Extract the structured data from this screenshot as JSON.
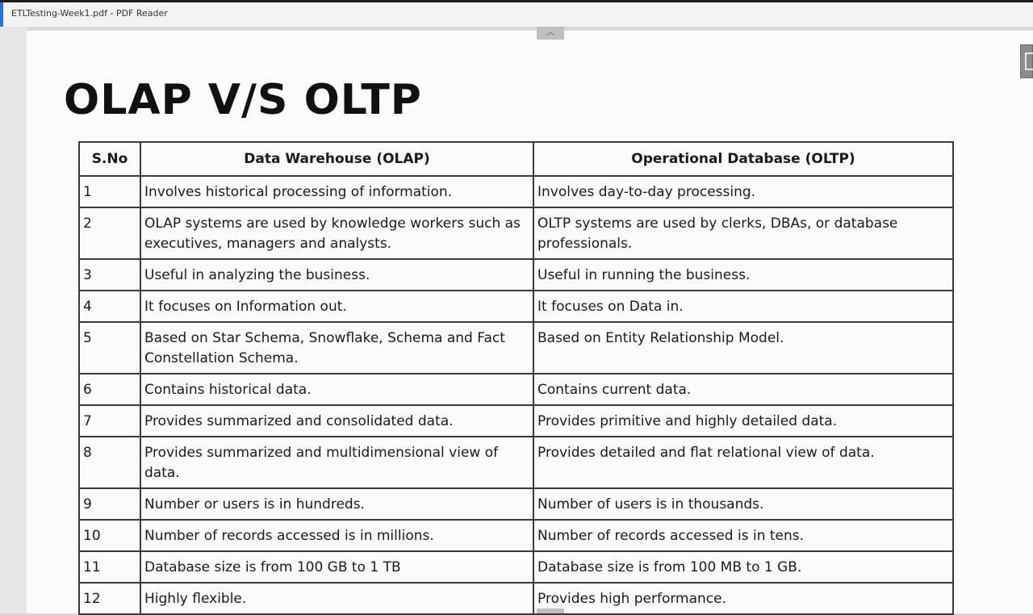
{
  "window": {
    "title": "ETLTesting-Week1.pdf - PDF Reader"
  },
  "document": {
    "heading": "OLAP V/S OLTP",
    "table": {
      "headers": [
        "S.No",
        "Data Warehouse (OLAP)",
        "Operational Database (OLTP)"
      ],
      "rows": [
        [
          "1",
          "Involves historical processing of information.",
          "Involves day-to-day processing."
        ],
        [
          "2",
          "OLAP systems are used by knowledge workers such as executives, managers and analysts.",
          "OLTP systems are used by clerks, DBAs, or database professionals."
        ],
        [
          "3",
          "Useful in analyzing the business.",
          "Useful in running the business."
        ],
        [
          "4",
          "It focuses on Information out.",
          "It focuses on Data in."
        ],
        [
          "5",
          "Based on Star Schema, Snowflake, Schema and Fact Constellation Schema.",
          "Based on Entity Relationship Model."
        ],
        [
          "6",
          "Contains historical data.",
          "Contains current data."
        ],
        [
          "7",
          "Provides summarized and consolidated data.",
          "Provides primitive and highly detailed data."
        ],
        [
          "8",
          "Provides summarized and multidimensional view of data.",
          "Provides detailed and flat relational view of data."
        ],
        [
          "9",
          "Number or users is in hundreds.",
          "Number of users is in thousands."
        ],
        [
          "10",
          "Number of records accessed is in millions.",
          "Number of records accessed is in tens."
        ],
        [
          "11",
          "Database size is from 100 GB to 1 TB",
          "Database size is from 100 MB to 1 GB."
        ],
        [
          "12",
          "Highly flexible.",
          "Provides high performance."
        ]
      ]
    }
  },
  "controls": {
    "scroll_up_icon": "chevron-up-icon",
    "side_panel_icon": "panel-toggle-icon"
  }
}
